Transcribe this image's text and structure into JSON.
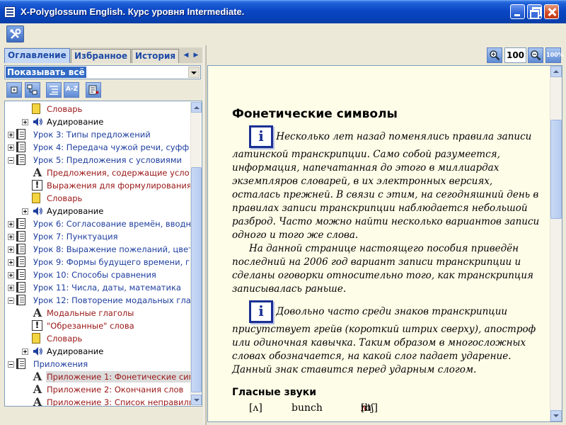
{
  "window": {
    "title": "X-Polyglossum English. Курс уровня Intermediate."
  },
  "toolbar": {
    "tools_icon": "tools-icon"
  },
  "tabs": [
    {
      "label": "Оглавление",
      "active": true
    },
    {
      "label": "Избранное",
      "active": false
    },
    {
      "label": "История",
      "active": false
    }
  ],
  "filter": {
    "selected": "Показывать всё"
  },
  "tree_toolbar": {
    "sort_az_label": "A-Z"
  },
  "tree": [
    {
      "type": "child",
      "icon": "yellow-book-icon",
      "label": "Словарь"
    },
    {
      "type": "nested",
      "icon": "speaker-icon",
      "label": "Аудирование",
      "expander": "plus"
    },
    {
      "type": "lesson",
      "icon": "book-icon",
      "label": "Урок 3: Типы предложений",
      "expander": "plus"
    },
    {
      "type": "lesson",
      "icon": "book-icon",
      "label": "Урок 4: Передача чужой речи, суфф",
      "expander": "plus"
    },
    {
      "type": "lesson",
      "icon": "book-icon",
      "label": "Урок 5: Предложения с условиями",
      "expander": "minus"
    },
    {
      "type": "child",
      "icon": "grammar-a-icon",
      "label": "Предложения, содержащие усло"
    },
    {
      "type": "child",
      "icon": "exclamation-icon",
      "label": "Выражения для формулирования"
    },
    {
      "type": "child",
      "icon": "yellow-book-icon",
      "label": "Словарь"
    },
    {
      "type": "nested",
      "icon": "speaker-icon",
      "label": "Аудирование",
      "expander": "plus"
    },
    {
      "type": "lesson",
      "icon": "book-icon",
      "label": "Урок 6: Согласование времён, вводн",
      "expander": "plus"
    },
    {
      "type": "lesson",
      "icon": "book-icon",
      "label": "Урок 7: Пунктуация",
      "expander": "plus"
    },
    {
      "type": "lesson",
      "icon": "book-icon",
      "label": "Урок 8: Выражение пожеланий, цвет",
      "expander": "plus"
    },
    {
      "type": "lesson",
      "icon": "book-icon",
      "label": "Урок 9: Формы будущего времени, г",
      "expander": "plus"
    },
    {
      "type": "lesson",
      "icon": "book-icon",
      "label": "Урок 10: Способы сравнения",
      "expander": "plus"
    },
    {
      "type": "lesson",
      "icon": "book-icon",
      "label": "Урок 11: Числа, даты, математика",
      "expander": "plus"
    },
    {
      "type": "lesson",
      "icon": "book-icon",
      "label": "Урок 12: Повторение модальных гла",
      "expander": "minus"
    },
    {
      "type": "child",
      "icon": "grammar-a-icon",
      "label": "Модальные глаголы"
    },
    {
      "type": "child",
      "icon": "exclamation-icon",
      "label": "\"Обрезанные\" слова"
    },
    {
      "type": "child",
      "icon": "yellow-book-icon",
      "label": "Словарь"
    },
    {
      "type": "nested",
      "icon": "speaker-icon",
      "label": "Аудирование",
      "expander": "plus"
    },
    {
      "type": "lesson",
      "icon": "book-icon",
      "label": "Приложения",
      "expander": "minus"
    },
    {
      "type": "child",
      "icon": "grammar-a-icon",
      "label": "Приложение 1: Фонетические сим",
      "selected": true
    },
    {
      "type": "child",
      "icon": "grammar-a-icon",
      "label": "Приложение 2: Окончания слов"
    },
    {
      "type": "child",
      "icon": "grammar-a-icon",
      "label": "Приложение 3: Список неправиль"
    }
  ],
  "zoom": {
    "value": "100",
    "reset_label": "100%"
  },
  "content": {
    "heading": "Фонетические символы",
    "info_icon_glyph": "i",
    "para1": "Несколько лет назад поменялись правила записи латинской транскрипции. Само собой разумеется, информация, напечатанная до этого в миллиардах экземпляров словарей, в их электронных версиях, осталась прежней. В связи с этим, на сегодняшний день в правилах записи транскрипции наблюдается небольшой разброд. Часто можно найти несколько вариантов записи одного и того же слова.",
    "para2": "На данной странице настоящего пособия приведён последний на 2006 год вариант записи транскрипции и сделаны оговорки относительно того, как транскрипция записывалась раньше.",
    "para3": "Довольно часто среди знаков транскрипции присутствует грейв (короткий штрих сверху), апостроф или одиночная кавычка. Таким образом  в многосложных словах обозначается, на какой слог падает ударение. Данный знак ставится перед ударным слогом.",
    "subheading": "Гласные звуки",
    "vowel_row": {
      "symbol": "[ʌ]",
      "word": "bunch",
      "trans_open": "[b",
      "trans_stress": "ʌ",
      "trans_rest": "ntʃ]"
    }
  },
  "colors": {
    "title_bar": "#0a46c4",
    "tab_text": "#1e49a6",
    "lesson_text": "#1e3e9e",
    "child_text": "#9a1616",
    "content_bg": "#fefde8",
    "info_icon": "#1a2f93"
  }
}
